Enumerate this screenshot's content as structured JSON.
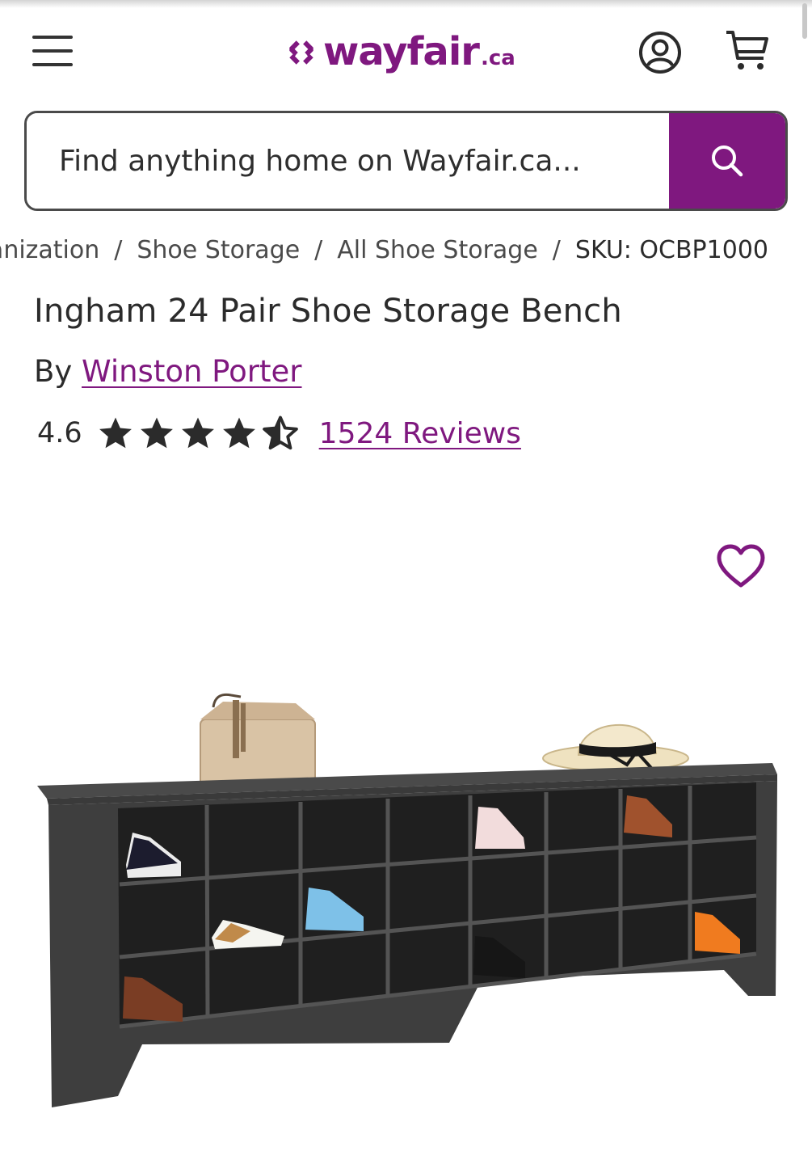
{
  "header": {
    "menu_icon": "hamburger-menu-icon",
    "logo": {
      "text": "wayfair",
      "tld": ".ca",
      "brand_color": "#7f187f"
    },
    "account_icon": "account-icon",
    "cart_icon": "cart-icon"
  },
  "search": {
    "placeholder": "Find anything home on Wayfair.ca...",
    "value": "",
    "button_icon": "search-icon",
    "button_color": "#7f187f"
  },
  "breadcrumb": {
    "items": [
      "Storage & Organization",
      "Shoe Storage",
      "All Shoe Storage"
    ],
    "current": "SKU: OCBP1000",
    "separator": "/"
  },
  "product": {
    "title": "Ingham 24 Pair Shoe Storage Bench",
    "by_label": "By",
    "brand": "Winston Porter",
    "rating": "4.6",
    "rating_fraction_of_5": 0.92,
    "reviews": "1524 Reviews",
    "favorite_icon": "heart-outline-icon"
  },
  "colors": {
    "brand_purple": "#7f187f",
    "text": "#2b2b2b"
  }
}
